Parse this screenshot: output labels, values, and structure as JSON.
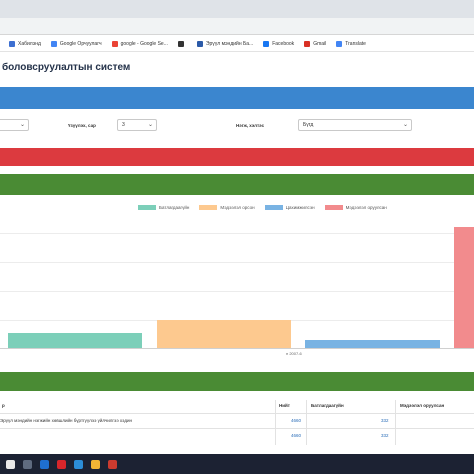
{
  "bookmarks": [
    {
      "label": "Хабилэнд",
      "color": "#3d6fd1"
    },
    {
      "label": "Google Орчуулагч",
      "color": "#4285f4"
    },
    {
      "label": "google - Google Se...",
      "color": "#ea4335"
    },
    {
      "label": "",
      "color": "#333333"
    },
    {
      "label": "Эрүүл мэндийн Ба...",
      "color": "#2b5aa8"
    },
    {
      "label": "Facebook",
      "color": "#1877f2"
    },
    {
      "label": "Gmail",
      "color": "#d93025"
    },
    {
      "label": "Translate",
      "color": "#4285f4"
    }
  ],
  "page": {
    "title": "боловсруулалтын систем"
  },
  "filters": {
    "label_2": "Үзүүлэх, сар",
    "value_2": "3",
    "label_3": "Нэгж, хэлтэс",
    "value_3": "Бүгд"
  },
  "chart_data": {
    "type": "bar",
    "categories": [
      "",
      "",
      "",
      ""
    ],
    "x_label_visible": "н 2007-6",
    "series": [
      {
        "name": "Батлагдаагүйн",
        "color": "#7ccfb9",
        "value": 12
      },
      {
        "name": "Мэдээлэл орсон",
        "color": "#fdc98f",
        "value": 23
      },
      {
        "name": "Цахимжилсэн",
        "color": "#79b3e3",
        "value": 7
      },
      {
        "name": "Мэдээлэл оруулсан",
        "color": "#f28b8d",
        "value": 100
      }
    ],
    "ylim": [
      0,
      110
    ],
    "grid": true,
    "legend": "top-center"
  },
  "table": {
    "headers": [
      "р",
      "Нийт",
      "Батлагдаагүйн",
      "Мэдээлэл оруулсан"
    ],
    "rows": [
      [
        "Эрүүл мэндийн нэгжийн хөвшлийн бүртгүүлээ үйлчилгээ хэдин",
        "4660",
        "332",
        ""
      ],
      [
        "",
        "4660",
        "332",
        ""
      ]
    ]
  },
  "taskbar": {
    "icons": [
      {
        "name": "windows-icon",
        "color": "#e9e9e9"
      },
      {
        "name": "search-icon",
        "color": "#5f6b80"
      },
      {
        "name": "outlook-icon",
        "color": "#1f6fcf"
      },
      {
        "name": "opera-icon",
        "color": "#d7262b"
      },
      {
        "name": "edge-icon",
        "color": "#2c8ed8"
      },
      {
        "name": "explorer-icon",
        "color": "#f2b535"
      },
      {
        "name": "chrome-icon",
        "color": "#cc3b2f"
      }
    ]
  }
}
